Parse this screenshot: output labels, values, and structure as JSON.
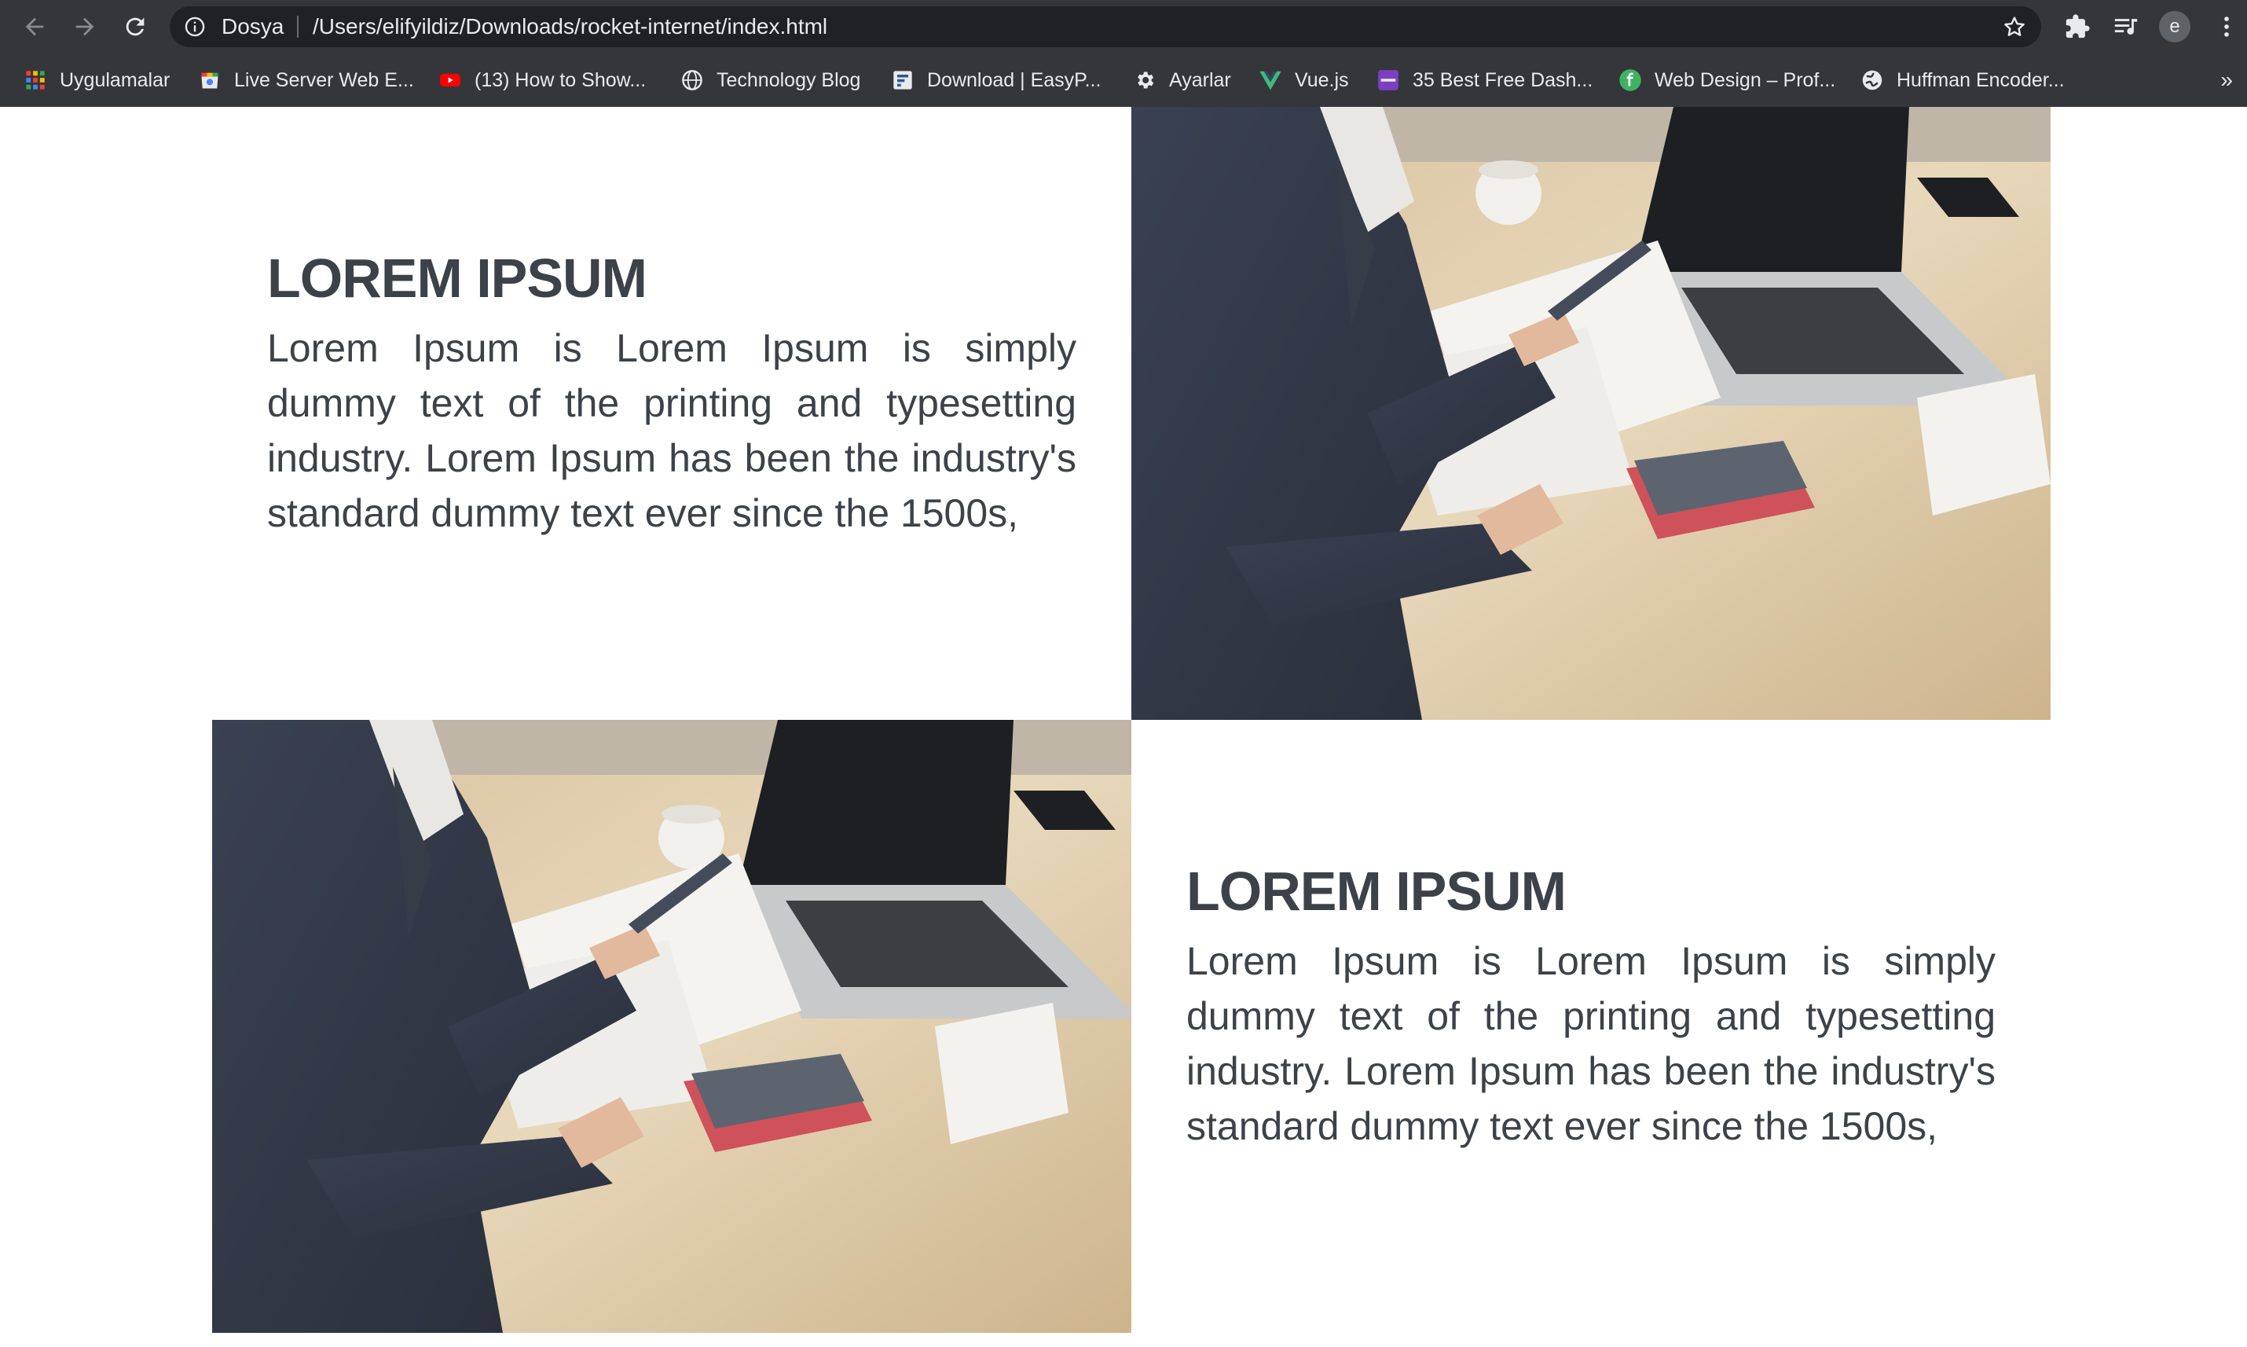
{
  "browser": {
    "scheme_label": "Dosya",
    "url": "/Users/elifyildiz/Downloads/rocket-internet/index.html",
    "avatar_letter": "e",
    "icons": [
      "back-icon",
      "forward-icon",
      "reload-icon",
      "info-icon",
      "star-icon",
      "extensions-icon",
      "media-icon",
      "menu-icon"
    ]
  },
  "bookmarks": {
    "items": [
      {
        "label": "Uygulamalar",
        "icon": "apps-grid-icon"
      },
      {
        "label": "Live Server Web E...",
        "icon": "store-icon"
      },
      {
        "label": "(13) How to Show...",
        "icon": "youtube-icon"
      },
      {
        "label": "Technology Blog",
        "icon": "globe-icon"
      },
      {
        "label": "Download | EasyP...",
        "icon": "easyp-icon"
      },
      {
        "label": "Ayarlar",
        "icon": "gear-icon"
      },
      {
        "label": "Vue.js",
        "icon": "vue-icon"
      },
      {
        "label": "35 Best Free Dash...",
        "icon": "colorlib-icon"
      },
      {
        "label": "Web Design – Prof...",
        "icon": "freelancer-icon"
      },
      {
        "label": "Huffman Encoder...",
        "icon": "globe-icon"
      }
    ],
    "more_label": "»"
  },
  "sections": [
    {
      "heading": "LOREM IPSUM",
      "text": "Lorem Ipsum is Lorem Ipsum is simply dummy text of the printing and typesetting industry. Lorem Ipsum has been the industry's standard dummy text ever since the 1500s,"
    },
    {
      "heading": "LOREM IPSUM",
      "text": "Lorem Ipsum is Lorem Ipsum is simply dummy text of the printing and typesetting industry. Lorem Ipsum has been the industry's standard dummy text ever since the 1500s,"
    }
  ],
  "colors": {
    "chrome": "#35363a",
    "omnibox": "#202124",
    "chrome_text": "#e8eaed",
    "heading_text": "#3d4249"
  }
}
